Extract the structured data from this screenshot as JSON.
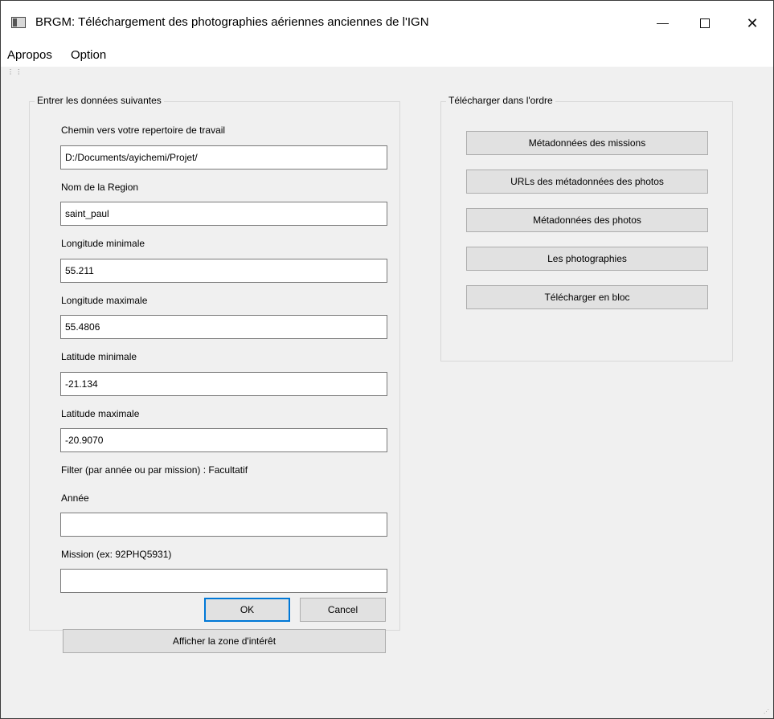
{
  "window": {
    "title": "BRGM: Téléchargement des photographies aériennes anciennes de l'IGN",
    "controls": {
      "close_glyph": "✕"
    }
  },
  "menu": {
    "items": [
      "Apropos",
      "Option"
    ]
  },
  "left_group": {
    "title": "Entrer les données suivantes",
    "fields": [
      {
        "label": "Chemin vers votre repertoire de travail",
        "value": "D:/Documents/ayichemi/Projet/"
      },
      {
        "label": "Nom de la Region",
        "value": "saint_paul"
      },
      {
        "label": "Longitude minimale",
        "value": "55.211"
      },
      {
        "label": "Longitude maximale",
        "value": "55.4806"
      },
      {
        "label": "Latitude minimale",
        "value": "-21.134"
      },
      {
        "label": "Latitude maximale",
        "value": "-20.9070"
      }
    ],
    "filter_label": "Filter (par année ou par mission) : Facultatif",
    "year": {
      "label": "Année",
      "value": ""
    },
    "mission": {
      "label": "Mission (ex: 92PHQ5931)",
      "value": ""
    },
    "ok_label": "OK",
    "cancel_label": "Cancel",
    "show_zone_label": "Afficher la zone d'intérêt"
  },
  "right_group": {
    "title": "Télécharger dans l'ordre",
    "buttons": [
      "Métadonnées des missions",
      "URLs des métadonnées des photos",
      "Métadonnées des photos",
      "Les photographies",
      "Télécharger en bloc"
    ]
  }
}
